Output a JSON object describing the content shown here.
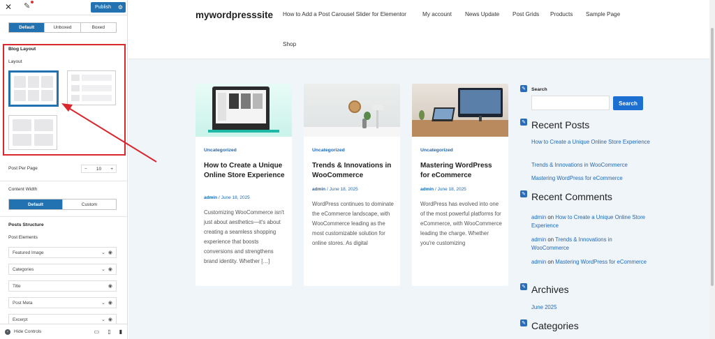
{
  "customizer": {
    "publish_label": "Publish",
    "container_tabs": [
      "Default",
      "Unboxed",
      "Boxed"
    ],
    "blog_layout_title": "Blog Layout",
    "layout_label": "Layout",
    "post_per_page_label": "Post Per Page",
    "post_per_page_value": "10",
    "content_width_label": "Content Width",
    "content_width_tabs": [
      "Default",
      "Custom"
    ],
    "posts_structure_title": "Posts Structure",
    "post_elements_label": "Post Elements",
    "post_elements": [
      "Featured Image",
      "Categories",
      "Title",
      "Post Meta",
      "Excerpt"
    ],
    "hide_controls_label": "Hide Controls",
    "icons": [
      "close-icon",
      "pencil-icon",
      "gear-icon",
      "chevron-down-icon",
      "eye-icon",
      "desktop-icon",
      "tablet-icon",
      "mobile-icon"
    ],
    "accent": "#2271b1",
    "highlight": "#d9272e"
  },
  "site": {
    "title": "mywordpresssite",
    "nav": [
      "How to Add a Post Carousel Slider for Elementor",
      "My account",
      "News Update",
      "Post Grids",
      "Products",
      "Sample Page",
      "Shop"
    ],
    "posts": [
      {
        "category": "Uncategorized",
        "title": "How to Create a Unique Online Store Experience",
        "author": "admin",
        "date": "June 18, 2025",
        "excerpt": "Customizing WooCommerce isn't just about aesthetics—it's about creating a seamless shopping experience that boosts conversions and strengthens brand identity. Whether […]"
      },
      {
        "category": "Uncategorized",
        "title": "Trends & Innovations in WooCommerce",
        "author": "admin",
        "date": "June 18, 2025",
        "excerpt": "WordPress continues to dominate the eCommerce landscape, with WooCommerce leading as the most customizable solution for online stores. As digital"
      },
      {
        "category": "Uncategorized",
        "title": "Mastering WordPress for eCommerce",
        "author": "admin",
        "date": "June 18, 2025",
        "excerpt": "WordPress has evolved into one of the most powerful platforms for eCommerce, with WooCommerce leading the charge. Whether you're customizing"
      }
    ],
    "widgets": {
      "search_label": "Search",
      "search_button": "Search",
      "recent_posts_title": "Recent Posts",
      "recent_posts": [
        "How to Create a Unique Online Store Experience",
        "Trends & Innovations in WooCommerce",
        "Mastering WordPress for eCommerce"
      ],
      "recent_comments_title": "Recent Comments",
      "comment_author": "admin",
      "comment_on": "on",
      "recent_comments": [
        "How to Create a Unique Online Store Experience",
        "Trends & Innovations in WooCommerce",
        "Mastering WordPress for eCommerce"
      ],
      "archives_title": "Archives",
      "archives": [
        "June 2025"
      ],
      "categories_title": "Categories"
    },
    "link_color": "#1d68b6",
    "button_color": "#1d6fd1"
  }
}
